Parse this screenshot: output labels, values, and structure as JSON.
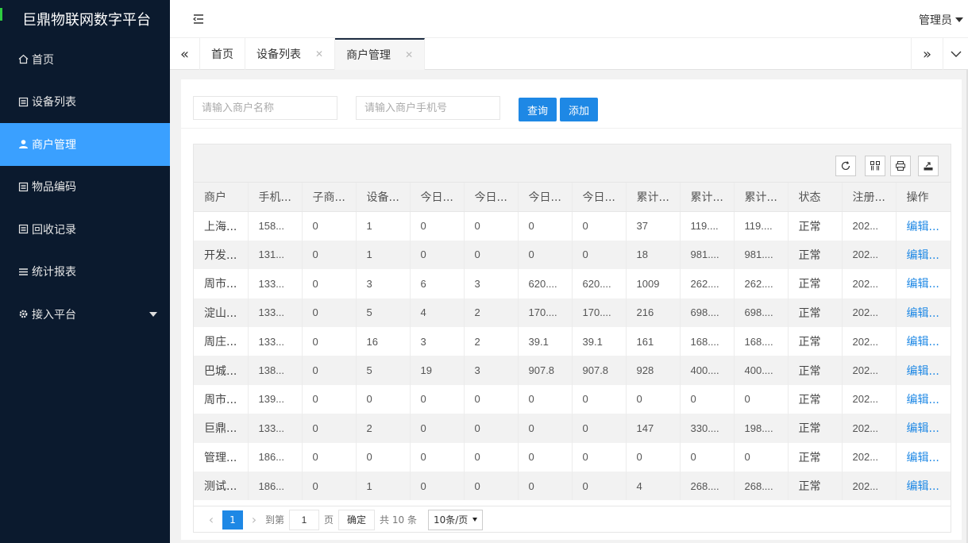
{
  "app": {
    "title": "巨鼎物联网数字平台"
  },
  "sidebar": {
    "items": [
      {
        "label": "首页",
        "icon": "home-icon",
        "active": false
      },
      {
        "label": "设备列表",
        "icon": "list-icon",
        "active": false
      },
      {
        "label": "商户管理",
        "icon": "user-icon",
        "active": true
      },
      {
        "label": "物品编码",
        "icon": "list-icon",
        "active": false
      },
      {
        "label": "回收记录",
        "icon": "list-icon",
        "active": false
      },
      {
        "label": "统计报表",
        "icon": "menu-icon",
        "active": false
      },
      {
        "label": "接入平台",
        "icon": "gear-icon",
        "active": false,
        "has_submenu": true
      }
    ]
  },
  "header": {
    "user_label": "管理员"
  },
  "tabs": [
    {
      "label": "首页",
      "closable": false,
      "active": false
    },
    {
      "label": "设备列表",
      "closable": true,
      "active": false
    },
    {
      "label": "商户管理",
      "closable": true,
      "active": true
    }
  ],
  "search": {
    "name_placeholder": "请输入商户名称",
    "phone_placeholder": "请输入商户手机号",
    "query_label": "查询",
    "add_label": "添加"
  },
  "table": {
    "columns": [
      "商户",
      "手机...",
      "子商...",
      "设备...",
      "今日...",
      "今日...",
      "今日...",
      "今日...",
      "累计...",
      "累计...",
      "累计...",
      "状态",
      "注册...",
      "操作"
    ],
    "rows": [
      [
        "上海...",
        "158...",
        "0",
        "1",
        "0",
        "0",
        "0",
        "0",
        "37",
        "119....",
        "119....",
        "正常",
        "202...",
        "编辑..."
      ],
      [
        "开发...",
        "131...",
        "0",
        "1",
        "0",
        "0",
        "0",
        "0",
        "18",
        "981....",
        "981....",
        "正常",
        "202...",
        "编辑..."
      ],
      [
        "周市...",
        "133...",
        "0",
        "3",
        "6",
        "3",
        "620....",
        "620....",
        "1009",
        "262....",
        "262....",
        "正常",
        "202...",
        "编辑..."
      ],
      [
        "淀山...",
        "133...",
        "0",
        "5",
        "4",
        "2",
        "170....",
        "170....",
        "216",
        "698....",
        "698....",
        "正常",
        "202...",
        "编辑..."
      ],
      [
        "周庄...",
        "133...",
        "0",
        "16",
        "3",
        "2",
        "39.1",
        "39.1",
        "161",
        "168....",
        "168....",
        "正常",
        "202...",
        "编辑..."
      ],
      [
        "巴城...",
        "138...",
        "0",
        "5",
        "19",
        "3",
        "907.8",
        "907.8",
        "928",
        "400....",
        "400....",
        "正常",
        "202...",
        "编辑..."
      ],
      [
        "周市...",
        "139...",
        "0",
        "0",
        "0",
        "0",
        "0",
        "0",
        "0",
        "0",
        "0",
        "正常",
        "202...",
        "编辑..."
      ],
      [
        "巨鼎...",
        "133...",
        "0",
        "2",
        "0",
        "0",
        "0",
        "0",
        "147",
        "330....",
        "198....",
        "正常",
        "202...",
        "编辑..."
      ],
      [
        "管理...",
        "186...",
        "0",
        "0",
        "0",
        "0",
        "0",
        "0",
        "0",
        "0",
        "0",
        "正常",
        "202...",
        "编辑..."
      ],
      [
        "测试...",
        "186...",
        "0",
        "1",
        "0",
        "0",
        "0",
        "0",
        "4",
        "268....",
        "268....",
        "正常",
        "202...",
        "编辑..."
      ]
    ]
  },
  "pagination": {
    "current_page": "1",
    "goto_prefix": "到第",
    "goto_value": "1",
    "goto_suffix": "页",
    "confirm_label": "确定",
    "total_label": "共 10 条",
    "page_size_label": "10条/页"
  },
  "colors": {
    "sidebar_bg": "#0b1a2e",
    "active_item": "#3aa0ff",
    "primary_button": "#1e88e5",
    "link": "#1e88e5"
  }
}
